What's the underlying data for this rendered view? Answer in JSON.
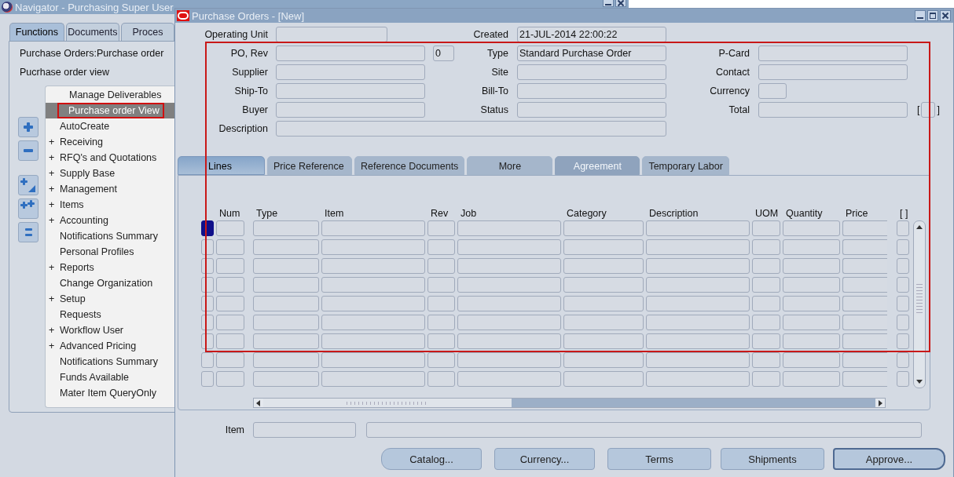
{
  "navigator": {
    "title": "Navigator - Purchasing Super User",
    "tabs": [
      {
        "label": "Functions",
        "selected": true
      },
      {
        "label": "Documents",
        "selected": false
      },
      {
        "label": "Proces",
        "selected": false
      }
    ],
    "path": "Purchase Orders:Purchase order",
    "heading": "Pucrhase order view",
    "tree": [
      {
        "children": [
          {
            "label": "Manage Deliverables",
            "selected": false,
            "highlighted": false
          },
          {
            "label": "Purchase order View",
            "selected": true,
            "highlighted": true
          }
        ]
      },
      {
        "label": "AutoCreate",
        "selected": false
      },
      {
        "label": "Receiving",
        "prefix": "+",
        "selected": false
      },
      {
        "label": "RFQ's and Quotations",
        "prefix": "+",
        "selected": false
      },
      {
        "label": "Supply Base",
        "prefix": "+",
        "selected": false
      },
      {
        "label": "Management",
        "prefix": "+",
        "selected": false
      },
      {
        "label": "Items",
        "prefix": "+",
        "selected": false
      },
      {
        "label": "Accounting",
        "prefix": "+",
        "selected": false
      },
      {
        "label": "Notifications Summary",
        "selected": false
      },
      {
        "label": "Personal Profiles",
        "selected": false
      },
      {
        "label": "Reports",
        "prefix": "+",
        "selected": false
      },
      {
        "label": "Change Organization",
        "selected": false
      },
      {
        "label": "Setup",
        "prefix": "+",
        "selected": false
      },
      {
        "label": "Requests",
        "selected": false
      },
      {
        "label": "Workflow User",
        "prefix": "+",
        "selected": false
      },
      {
        "label": "Advanced Pricing",
        "prefix": "+",
        "selected": false
      },
      {
        "label": "Notifications Summary",
        "selected": false
      },
      {
        "label": "Funds Available",
        "selected": false
      },
      {
        "label": "Mater Item QueryOnly",
        "selected": false
      }
    ]
  },
  "po_window": {
    "title": "Purchase Orders - [New]",
    "highlighted": true,
    "header": {
      "operating_unit": {
        "label": "Operating Unit"
      },
      "created": {
        "label": "Created",
        "value": "21-JUL-2014 22:00:22"
      },
      "po_rev": {
        "label": "PO, Rev",
        "rev": "0"
      },
      "type": {
        "label": "Type",
        "value": "Standard Purchase Order"
      },
      "p_card": {
        "label": "P-Card"
      },
      "supplier": {
        "label": "Supplier"
      },
      "site": {
        "label": "Site"
      },
      "contact": {
        "label": "Contact"
      },
      "ship_to": {
        "label": "Ship-To"
      },
      "bill_to": {
        "label": "Bill-To"
      },
      "currency": {
        "label": "Currency"
      },
      "buyer": {
        "label": "Buyer"
      },
      "status": {
        "label": "Status"
      },
      "total": {
        "label": "Total",
        "open": "[",
        "close": "]"
      },
      "description": {
        "label": "Description"
      }
    },
    "tabs": [
      {
        "label": "Lines",
        "selected": true,
        "disabled": false
      },
      {
        "label": "Price Reference",
        "selected": false,
        "disabled": false
      },
      {
        "label": "Reference Documents",
        "selected": false,
        "disabled": false
      },
      {
        "label": "More",
        "selected": false,
        "disabled": false
      },
      {
        "label": "Agreement",
        "selected": false,
        "disabled": true
      },
      {
        "label": "Temporary Labor",
        "selected": false,
        "disabled": false
      }
    ],
    "lines": {
      "columns": [
        "Num",
        "Type",
        "Item",
        "Rev",
        "Job",
        "Category",
        "Description",
        "UOM",
        "Quantity",
        "Price",
        "[ ]"
      ],
      "rows": [
        {
          "current": true
        },
        {
          "current": false
        },
        {
          "current": false
        },
        {
          "current": false
        },
        {
          "current": false
        },
        {
          "current": false
        },
        {
          "current": false
        },
        {
          "current": false
        },
        {
          "current": false
        }
      ]
    },
    "item": {
      "label": "Item"
    },
    "buttons": [
      {
        "label": "Catalog...",
        "default": false
      },
      {
        "label": "Currency...",
        "default": false
      },
      {
        "label": "Terms",
        "default": false
      },
      {
        "label": "Shipments",
        "default": false
      },
      {
        "label": "Approve...",
        "default": true
      }
    ]
  }
}
